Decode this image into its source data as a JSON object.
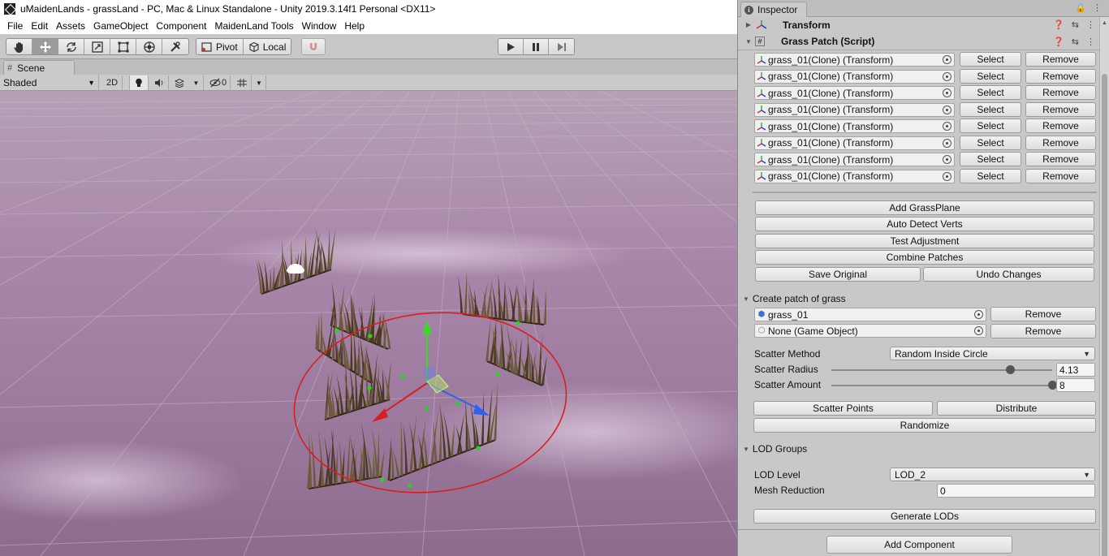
{
  "window": {
    "title": "uMaidenLands - grassLand - PC, Mac & Linux Standalone - Unity 2019.3.14f1 Personal <DX11>"
  },
  "menu": [
    "File",
    "Edit",
    "Assets",
    "GameObject",
    "Component",
    "MaidenLand Tools",
    "Window",
    "Help"
  ],
  "toolbar": {
    "tools": [
      "hand-tool",
      "move-tool",
      "rotate-tool",
      "scale-tool",
      "rect-tool",
      "transform-tool",
      "custom-tool"
    ],
    "active_tool": "move-tool",
    "pivot_label": "Pivot",
    "space_label": "Local"
  },
  "scene": {
    "tab_label": "Scene",
    "shading_mode": "Shaded",
    "mode_2d_label": "2D",
    "hidden_count": "0"
  },
  "inspector": {
    "tab_label": "Inspector",
    "transform_header": "Transform",
    "script_header": "Grass Patch (Script)",
    "patches": [
      "grass_01(Clone) (Transform)",
      "grass_01(Clone) (Transform)",
      "grass_01(Clone) (Transform)",
      "grass_01(Clone) (Transform)",
      "grass_01(Clone) (Transform)",
      "grass_01(Clone) (Transform)",
      "grass_01(Clone) (Transform)",
      "grass_01(Clone) (Transform)"
    ],
    "select_label": "Select",
    "remove_label": "Remove",
    "add_grassplane": "Add GrassPlane",
    "auto_detect": "Auto Detect Verts",
    "test_adjustment": "Test Adjustment",
    "combine_patches": "Combine Patches",
    "save_original": "Save Original",
    "undo_changes": "Undo Changes",
    "create_patch_header": "Create patch of grass",
    "prefab_1": "grass_01",
    "prefab_2": "None (Game Object)",
    "scatter_method_label": "Scatter Method",
    "scatter_method_value": "Random Inside Circle",
    "scatter_radius_label": "Scatter Radius",
    "scatter_radius_value": "4.13",
    "scatter_radius_fraction": 0.81,
    "scatter_amount_label": "Scatter Amount",
    "scatter_amount_value": "8",
    "scatter_amount_fraction": 1.0,
    "scatter_points": "Scatter Points",
    "distribute": "Distribute",
    "randomize": "Randomize",
    "lod_header": "LOD Groups",
    "lod_level_label": "LOD Level",
    "lod_level_value": "LOD_2",
    "mesh_reduction_label": "Mesh Reduction",
    "mesh_reduction_value": "0",
    "generate_lods": "Generate LODs",
    "add_component": "Add Component"
  },
  "colors": {
    "gizmo_red": "#d81f1f",
    "gizmo_green": "#3fd62b",
    "gizmo_blue": "#2f62e8",
    "sky_purple": "#a883a9",
    "grass": "#4b3a22"
  }
}
